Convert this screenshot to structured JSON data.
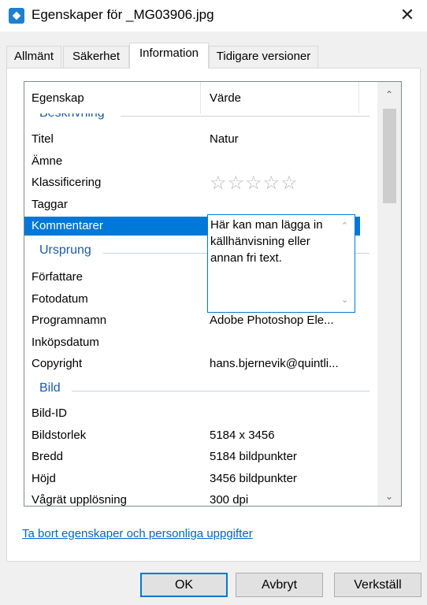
{
  "window": {
    "title": "Egenskaper för _MG03906.jpg",
    "close_symbol": "✕"
  },
  "tabs": [
    "Allmänt",
    "Säkerhet",
    "Information",
    "Tidigare versioner"
  ],
  "active_tab": "Information",
  "list": {
    "header": {
      "property": "Egenskap",
      "value": "Värde"
    },
    "groups": {
      "beskrivning": "Beskrivning",
      "ursprung": "Ursprung",
      "bild": "Bild"
    },
    "rows": {
      "titel": {
        "p": "Titel",
        "v": "Natur"
      },
      "amne": {
        "p": "Ämne",
        "v": ""
      },
      "klassificering": {
        "p": "Klassificering",
        "rating": 0,
        "stars": "☆☆☆☆☆"
      },
      "taggar": {
        "p": "Taggar",
        "v": ""
      },
      "kommentarer": {
        "p": "Kommentarer"
      },
      "forfattare": {
        "p": "Författare",
        "v": ""
      },
      "fotodatum": {
        "p": "Fotodatum",
        "v": ""
      },
      "programnamn": {
        "p": "Programnamn",
        "v": "Adobe Photoshop Ele..."
      },
      "inkopsdatum": {
        "p": "Inköpsdatum",
        "v": ""
      },
      "copyright": {
        "p": "Copyright",
        "v": "hans.bjernevik@quintli..."
      },
      "bildid": {
        "p": "Bild-ID",
        "v": ""
      },
      "bildstorlek": {
        "p": "Bildstorlek",
        "v": "5184 x 3456"
      },
      "bredd": {
        "p": "Bredd",
        "v": "5184 bildpunkter"
      },
      "hojd": {
        "p": "Höjd",
        "v": "3456 bildpunkter"
      },
      "vagratt": {
        "p": "Vågrät upplösning",
        "v": "300 dpi"
      }
    },
    "comment_edit_value": "Här kan man lägga in källhänvisning eller annan fri text."
  },
  "remove_link": "Ta bort egenskaper och personliga uppgifter",
  "buttons": {
    "ok": "OK",
    "cancel": "Avbryt",
    "apply": "Verkställ"
  },
  "colors": {
    "selection": "#0078d7",
    "group_header": "#1b5ba8",
    "link": "#0066cc"
  }
}
